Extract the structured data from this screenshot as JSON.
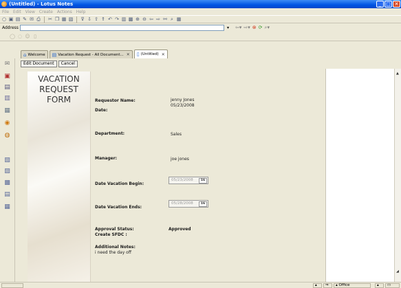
{
  "window": {
    "title": "(Untitled) - Lotus Notes"
  },
  "menu": [
    "File",
    "Edit",
    "View",
    "Create",
    "Actions",
    "Help"
  ],
  "address": {
    "label": "Address",
    "value": ""
  },
  "tabs": [
    {
      "label": "Welcome"
    },
    {
      "label": "Vacation Request - All Document..."
    },
    {
      "label": "(Untitled)"
    }
  ],
  "actions": {
    "edit_label": "Edit Document",
    "cancel_label": "Cancel"
  },
  "form": {
    "title_line1": "VACATION",
    "title_line2": "REQUEST",
    "title_line3": "FORM",
    "requestor_label": "Requestor  Name:",
    "requestor_value": "jenny Jones",
    "date_label": "Date:",
    "date_value": "05/23/2008",
    "department_label": "Department:",
    "department_value": "Sales",
    "manager_label": "Manager:",
    "manager_value": "joe jones",
    "begin_label": "Date Vacation Begin:",
    "begin_value": "05/23/2008",
    "ends_label": "Date Vacation Ends:",
    "ends_value": "05/28/2008",
    "calendar_btn": "16",
    "approval_label": "Approval Status:",
    "approval_value": "Approved",
    "sfdc_label": "Create SFDC :",
    "notes_label": "Additional Notes:",
    "notes_value": "i need the day off"
  },
  "status": {
    "location": "Office"
  },
  "colors": {
    "titlebar": "#0054E3",
    "chrome": "#ECE9D8",
    "close": "#d8502f"
  }
}
